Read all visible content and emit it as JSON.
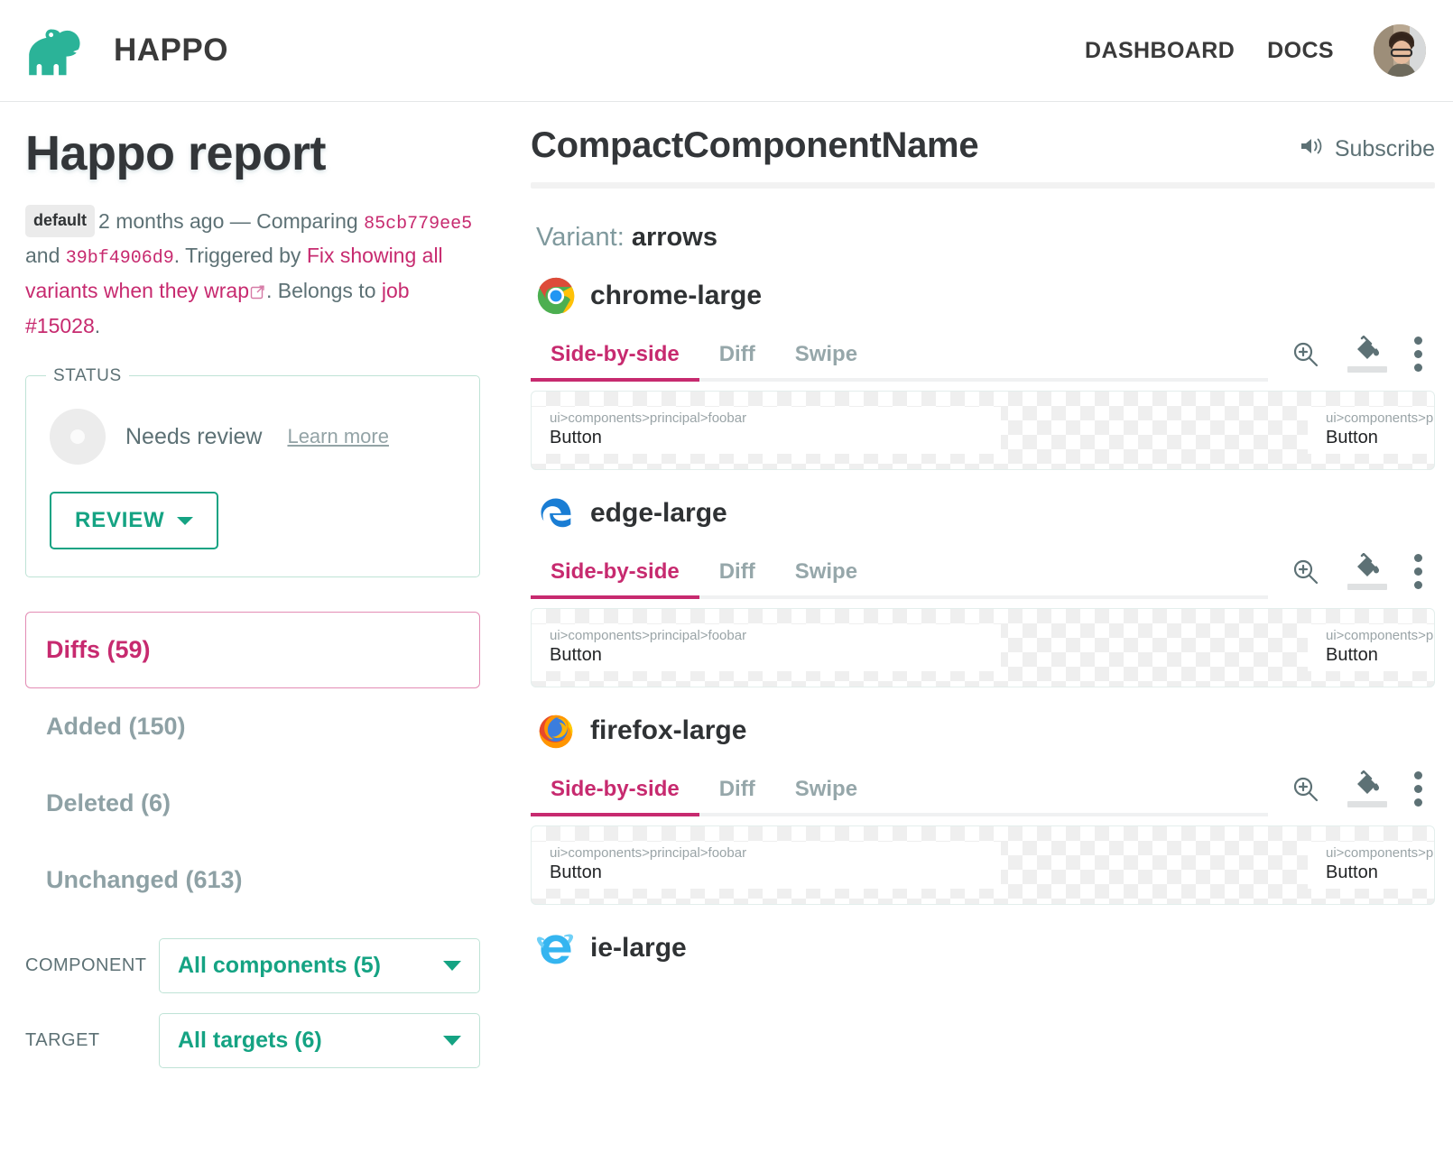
{
  "header": {
    "logo_icon": "hippo-logo-icon",
    "brand": "HAPPO",
    "nav": [
      {
        "label": "DASHBOARD",
        "name": "nav-dashboard"
      },
      {
        "label": "DOCS",
        "name": "nav-docs"
      }
    ],
    "avatar_label": ""
  },
  "sidebar": {
    "title": "Happo report",
    "meta": {
      "badge": "default",
      "time": "2 months ago — Comparing ",
      "hash_before": "85cb779ee5",
      "and": " and ",
      "hash_after": "39bf4906d9",
      "triggered_prefix": ". Triggered by ",
      "trigger_link": "Fix showing all variants when they wrap",
      "belongs_prefix": ". Belongs to ",
      "job_link": "job #15028",
      "period": "."
    },
    "status": {
      "legend": "STATUS",
      "state": "Needs review",
      "learn_more": "Learn more",
      "review_button": "REVIEW"
    },
    "filters": [
      {
        "label": "Diffs (59)",
        "name": "filter-diffs",
        "active": true
      },
      {
        "label": "Added (150)",
        "name": "filter-added",
        "active": false
      },
      {
        "label": "Deleted (6)",
        "name": "filter-deleted",
        "active": false
      },
      {
        "label": "Unchanged (613)",
        "name": "filter-unchanged",
        "active": false
      }
    ],
    "selects": [
      {
        "label": "COMPONENT",
        "value": "All components (5)",
        "name": "component-select"
      },
      {
        "label": "TARGET",
        "value": "All targets (6)",
        "name": "target-select"
      }
    ]
  },
  "main": {
    "component_title": "CompactComponentName",
    "subscribe": {
      "icon": "speaker-icon",
      "label": "Subscribe"
    },
    "variant_label": "Variant:",
    "variant_name": "arrows",
    "tabs": [
      "Side-by-side",
      "Diff",
      "Swipe"
    ],
    "active_tab": "Side-by-side",
    "tools": [
      "zoom-in-icon",
      "paint-bucket-icon",
      "more-options-icon"
    ],
    "browsers": [
      {
        "name": "chrome-large",
        "icon": "chrome-icon"
      },
      {
        "name": "edge-large",
        "icon": "edge-icon"
      },
      {
        "name": "firefox-large",
        "icon": "firefox-icon"
      },
      {
        "name": "ie-large",
        "icon": "internet-explorer-icon"
      }
    ],
    "snapshot": {
      "path": "ui>components>principal>foobar",
      "button_label": "Button",
      "path_truncated": "ui>components>"
    }
  },
  "colors": {
    "brand_teal": "#15a383",
    "accent_pink": "#c72a6f",
    "muted": "#5d7175"
  }
}
